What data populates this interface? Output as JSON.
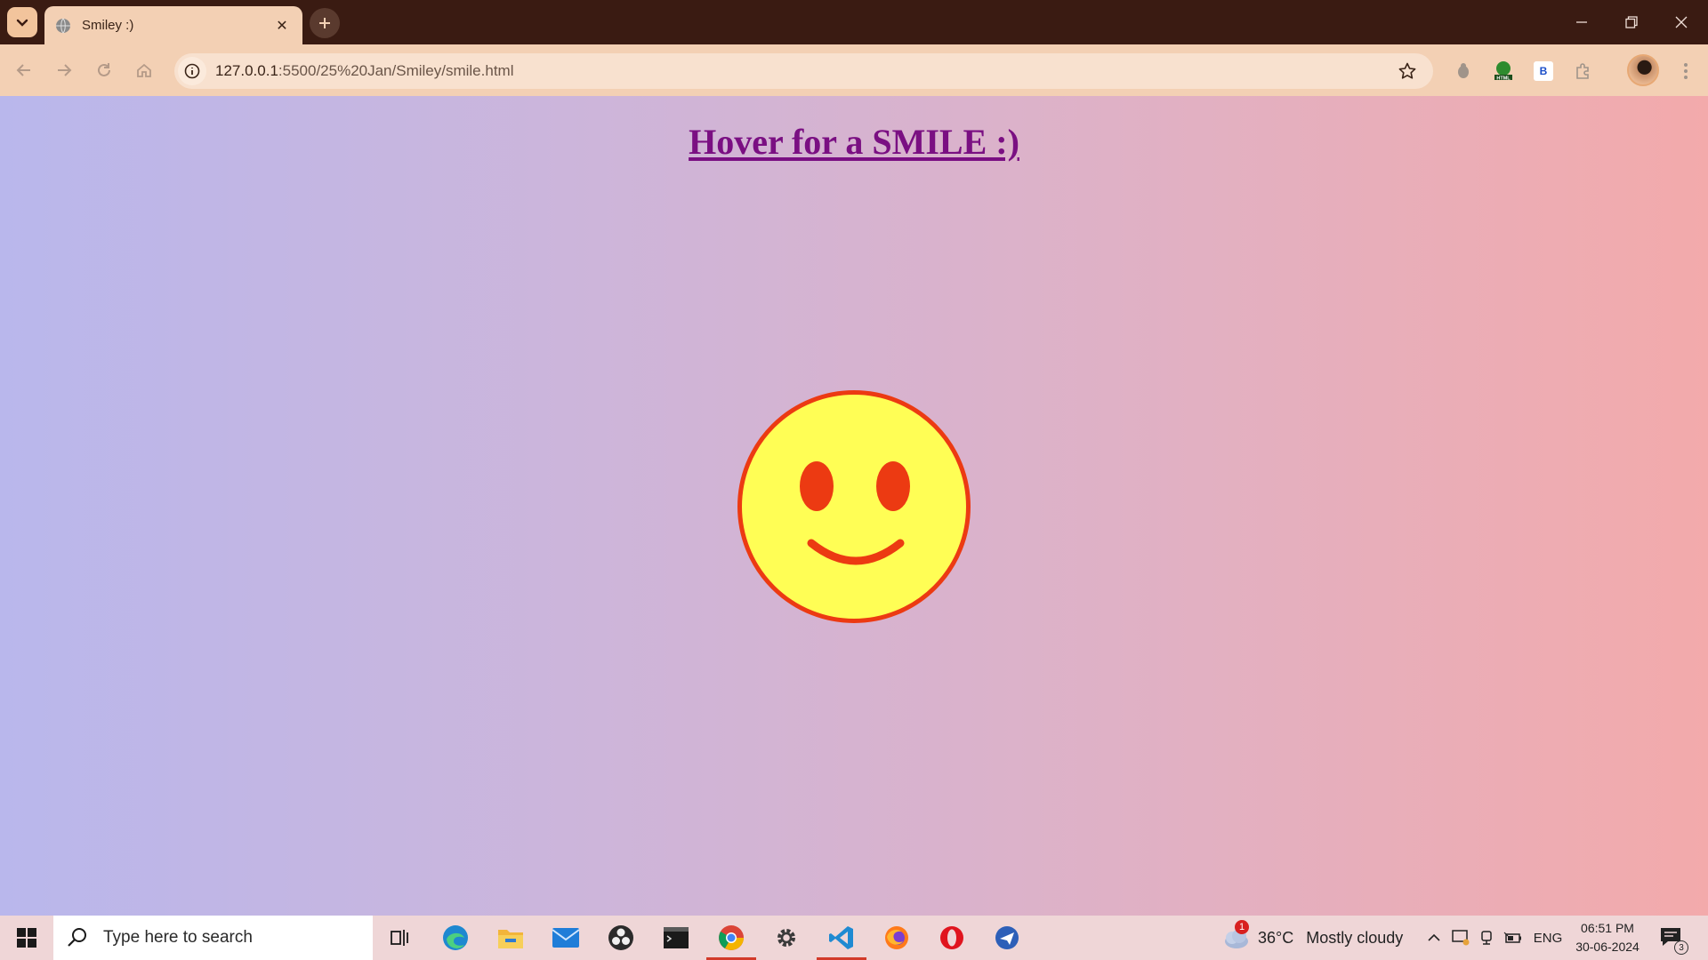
{
  "browser": {
    "tab": {
      "title": "Smiley :)",
      "close_glyph": "✕"
    },
    "new_tab_glyph": "+",
    "url_host": "127.0.0.1",
    "url_rest": ":5500/25%20Jan/Smiley/smile.html",
    "extensions": [
      "puzzle-extension-icon",
      "html-extension-icon",
      "b-extension-icon",
      "extensions-icon"
    ],
    "extension_b_label": "B",
    "extension_html_label": "HTML"
  },
  "page": {
    "heading": "Hover for a SMILE :)",
    "colors": {
      "face": "#fffe55",
      "features": "#ec3a12",
      "heading": "#7a0f82"
    }
  },
  "taskbar": {
    "search_placeholder": "Type here to search",
    "apps": [
      "task-view-icon",
      "edge-icon",
      "file-explorer-icon",
      "mail-icon",
      "obs-icon",
      "terminal-icon",
      "chrome-icon",
      "settings-icon",
      "vscode-icon",
      "firefox-icon",
      "opera-icon",
      "send-icon"
    ],
    "weather": {
      "temp": "36°C",
      "condition": "Mostly cloudy",
      "badge": "1"
    },
    "language": "ENG",
    "time": "06:51 PM",
    "date": "30-06-2024",
    "notification_count": "3"
  }
}
